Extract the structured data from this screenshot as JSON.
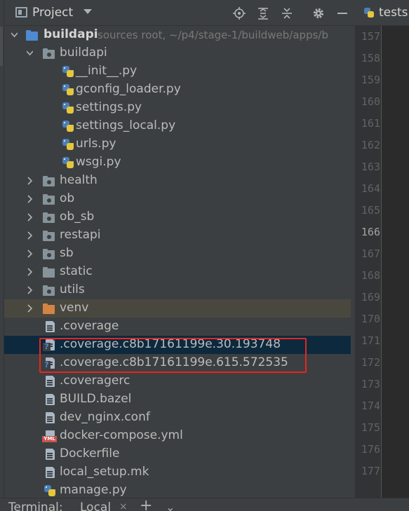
{
  "header": {
    "title": "Project",
    "icons": [
      "project-view-icon",
      "dropdown-caret-icon",
      "locate-icon",
      "expand-all-icon",
      "collapse-all-icon",
      "gear-icon",
      "hide-icon"
    ]
  },
  "editor_tab": {
    "label": "tests."
  },
  "tree": {
    "root": {
      "label": "buildapi",
      "hint": "sources root,  ~/p4/stage-1/buildweb/apps/b"
    },
    "pkg": {
      "label": "buildapi"
    },
    "py_files": [
      "__init__.py",
      "gconfig_loader.py",
      "settings.py",
      "settings_local.py",
      "urls.py",
      "wsgi.py"
    ],
    "packages": [
      "health",
      "ob",
      "ob_sb",
      "restapi",
      "sb"
    ],
    "static": "static",
    "utils": "utils",
    "venv": "venv",
    "files": {
      "coverage": ".coverage",
      "cov1": ".coverage.c8b17161199e.30.193748",
      "cov2": ".coverage.c8b17161199e.615.572535",
      "coveragerc": ".coveragerc",
      "build": "BUILD.bazel",
      "nginx": "dev_nginx.conf",
      "compose": "docker-compose.yml",
      "dockerfile": "Dockerfile",
      "local_setup": "local_setup.mk",
      "manage": "manage.py"
    },
    "yml_badge": "YML"
  },
  "gutter": {
    "lines": [
      "157",
      "158",
      "159",
      "160",
      "161",
      "162",
      "163",
      "164",
      "165",
      "166",
      "167",
      "168",
      "169",
      "170",
      "171",
      "172",
      "173",
      "174",
      "175",
      "176",
      "177"
    ],
    "current": "166"
  },
  "bottom": {
    "terminal_label": "Terminal:",
    "tab_label": "Local",
    "close_glyph": "×",
    "plus_glyph": "+",
    "caret_glyph": "⌄"
  },
  "colors": {
    "panel_bg": "#3c3f41",
    "editor_bg": "#2b2b2b",
    "selection": "#0d293e",
    "ignored_row": "#49483f",
    "highlight_box": "#e8261d",
    "source_folder": "#4e8ad1",
    "excluded_folder": "#d28445"
  }
}
